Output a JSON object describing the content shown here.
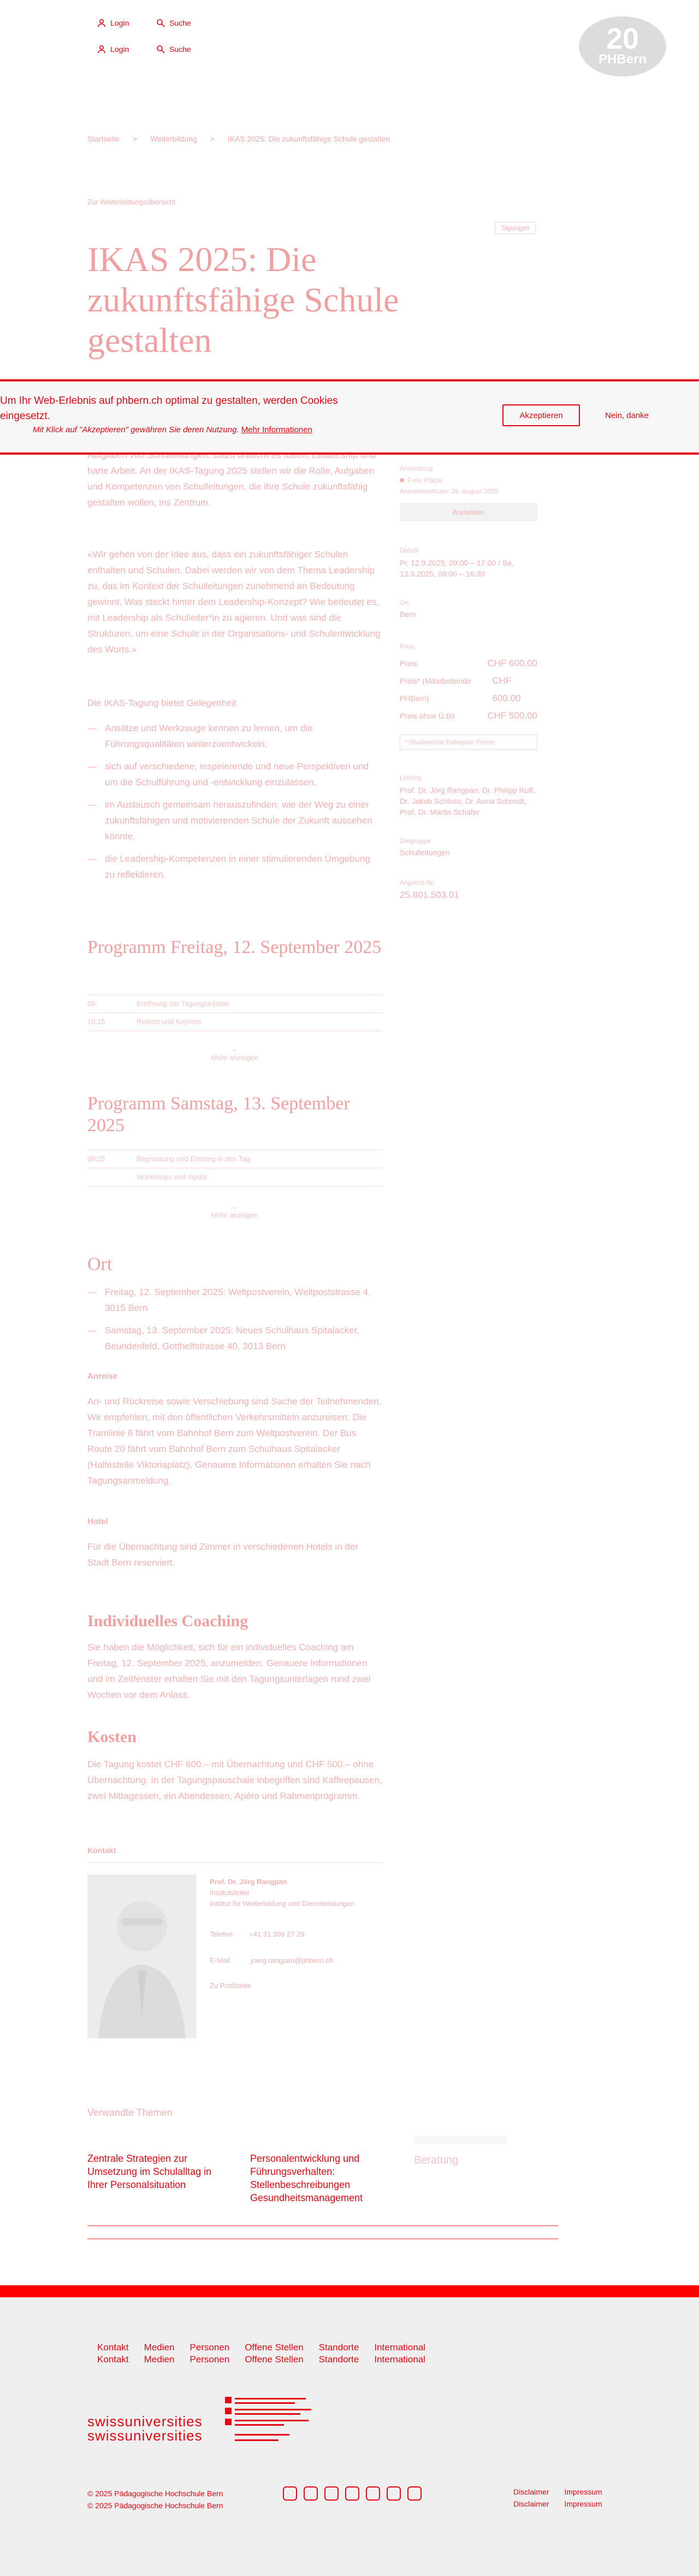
{
  "header": {
    "login_label": "Login",
    "search_label": "Suche",
    "logo_number": "20",
    "logo_brand": "PHBern"
  },
  "breadcrumb": [
    "Startseite",
    "Weiterbildung",
    "IKAS 2025: Die zukunftsfähige Schule gestalten"
  ],
  "category": "Zur Weiterbildungsübersicht",
  "badge": "Tagungen",
  "title": "IKAS 2025: Die zukunftsfähige Schule gestalten",
  "cookie": {
    "message": "Um Ihr Web-Erlebnis auf phbern.ch optimal zu gestalten, werden Cookies eingesetzt.",
    "hint": "Mit Klick auf \"Akzeptieren\" gewähren Sie deren Nutzung.",
    "more_info": "Mehr Informationen",
    "accept_label": "Akzeptieren",
    "decline_label": "Nein, danke"
  },
  "intro": "Aufgaben von Schulleitungen. Dazu braucht es Ideen, Leadership und harte Arbeit. An der IKAS-Tagung 2025 stellen wir die Rolle, Aufgaben und Kompetenzen von Schulleitungen, die ihre Schule zukunftsfähig gestalten wollen, ins Zentrum.",
  "quote": "«Wir gehen von der Idee aus, dass ein zukunftsfähiger Schulen enthalten und Schulen. Dabei werden wir von dem Thema Leadership zu, das im Kontext der Schulleitungen zunehmend an Bedeutung gewinnt. Was steckt hinter dem Leadership-Konzept? Wie bedeutet es, mit Leadership als Schulleiter*in zu agieren. Und was sind die Strukturen, um eine Schule in der Organisations- und Schulentwicklung des Worts.»",
  "categories_intro": "Die IKAS-Tagung bietet Gelegenheit",
  "bullets": [
    "Ansätze und Werkzeuge kennen zu lernen, um die Führungsqualitäten weiterzuentwickeln,",
    "sich auf verschiedene, inspirierende und neue Perspektiven und um die Schulführung und -entwicklung einzulassen,",
    "im Austausch gemeinsam herauszufinden, wie der Weg zu einer zukunftsfähigen und motivierenden Schule der Zukunft aussehen könnte,",
    "die Leadership-Kompetenzen in einer stimulierenden Umgebung zu reflektieren."
  ],
  "program_fri": {
    "title": "Programm Freitag, 12. September 2025",
    "rows": [
      {
        "time": "09:",
        "text": "Eröffnung der Tagungsinhalte"
      },
      {
        "time": "10:15",
        "text": "Referat und Keynote"
      }
    ],
    "more": "Mehr anzeigen"
  },
  "program_sat": {
    "title": "Programm Samstag, 13. September 2025",
    "rows": [
      {
        "time": "09:15",
        "text": "Begrüssung und Einstieg in den Tag"
      },
      {
        "time": "",
        "text": "Workshops und Inputs"
      }
    ],
    "more": "Mehr anzeigen"
  },
  "venue": {
    "title": "Ort",
    "items": [
      "Freitag, 12. September 2025: Weltpostverein, Weltpoststrasse 4, 3015 Bern",
      "Samstag, 13. September 2025: Neues Schulhaus Spitalacker, Beundenfeld, Gotthelfstrasse 40, 3013 Bern"
    ],
    "arrival_title": "Anreise",
    "arrival_text": "An- und Rückreise sowie Verschiebung sind Sache der Teilnehmenden. Wir empfehlen, mit den öffentlichen Verkehrsmitteln anzureisen. Die Tramlinie 6 fährt vom Bahnhof Bern zum Weltpostverein. Der Bus Route 20 fährt vom Bahnhof Bern zum Schulhaus Spitalacker (Haltestelle Viktoriaplatz). Genauere Informationen erhalten Sie nach Tagungsanmeldung.",
    "hotel_title": "Hotel",
    "hotel_text": "Für die Übernachtung sind Zimmer in verschiedenen Hotels in der Stadt Bern reserviert."
  },
  "coaching": {
    "title": "Individuelles Coaching",
    "text": "Sie haben die Möglichkeit, sich für ein individuelles Coaching am Freitag, 12. September 2025, anzumelden. Genauere Informationen und im Zeitfenster erhalten Sie mit den Tagungsunterlagen rund zwei Wochen vor dem Anlass."
  },
  "costs": {
    "title": "Kosten",
    "text": "Die Tagung kostet CHF 600.– mit Übernachtung und CHF 500.– ohne Übernachtung. In der Tagungspauschale inbegriffen sind Kaffeepausen, zwei Mittagessen, ein Abendessen, Apéro und Rahmenprogramm."
  },
  "contact": {
    "label": "Kontakt",
    "name": "Prof. Dr. Jörg Rangpan",
    "role": "Institutsleiter",
    "unit": "Institut für Weiterbildung und Dienstleistungen",
    "phone_label": "Telefon",
    "phone": "+41 31 309 27 29",
    "email_label": "E-Mail",
    "email": "joerg.rangpan@phbern.ch",
    "more": "Zu Profilseite"
  },
  "sidebar": {
    "reg_label": "Anmeldung",
    "status": "Freie Plätze",
    "deadline": "Anmeldeschluss: 28. August 2025",
    "register_button": "Anmelden",
    "date_label": "Datum",
    "date_value": "Fr, 12.9.2025, 09:00 – 17:00 / Sa, 13.9.2025, 09:00 – 16:30",
    "place_label": "Ort",
    "place_value": "Bern",
    "price_label": "Preis",
    "prices": [
      {
        "label": "Preis",
        "value": "CHF 600.00"
      },
      {
        "label": "Preis* (Mitarbeitende PHBern)",
        "value": "CHF 600.00"
      },
      {
        "label": "Preis ohne Ü.Bit",
        "value": "CHF 500.00"
      }
    ],
    "price_note": "* Studierende Kategorie Preise",
    "lead_label": "Leitung",
    "lead_value": "Prof. Dr. Jörg Rangpan, Dr. Philipp Ruff, Dr. Jakob Schloss, Dr. Anna Schmidt, Prof. Dr. Martin Schäfer",
    "target_label": "Zielgruppe",
    "target_value": "Schulleitungen",
    "number_label": "Angebot-Nr.",
    "number_value": "25.801.503.01"
  },
  "related": {
    "label": "Verwandte Themen",
    "items": [
      "Zentrale Strategien zur Umsetzung im Schulalltag in Ihrer Personalsituation",
      "Personalentwicklung und Führungsverhalten: Stellenbeschreibungen Gesundheitsmanagement",
      "Beratung"
    ]
  },
  "footer": {
    "nav": [
      "Kontakt",
      "Medien",
      "Personen",
      "Offene Stellen",
      "Standorte",
      "International"
    ],
    "swiss": "swissuniversities",
    "copyright": "© 2025 Pädagogische Hochschule Bern",
    "legal": [
      "Disclaimer",
      "Impressum"
    ]
  },
  "colors": {
    "accent": "#e30613",
    "faded_text": "#f3b1b1",
    "footer_bg": "#efefef"
  }
}
